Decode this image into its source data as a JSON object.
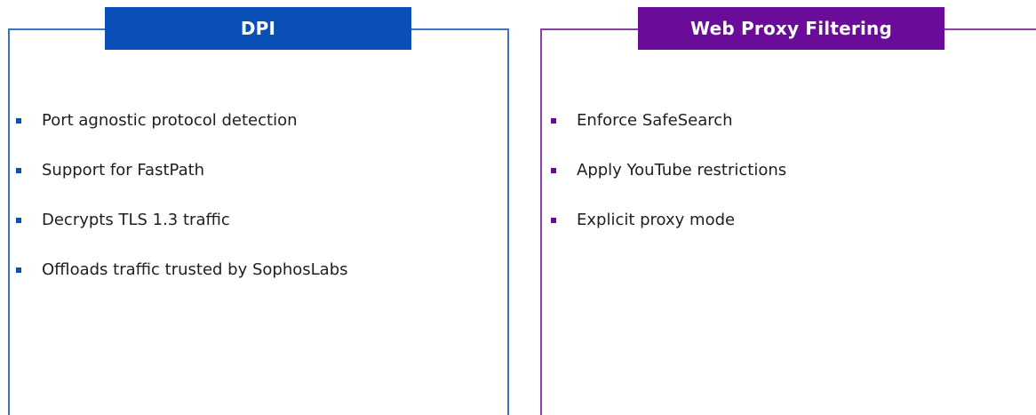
{
  "left_panel": {
    "title": "DPI",
    "accent_color": "#0a4fb6",
    "items": [
      "Port agnostic protocol detection",
      "Support for FastPath",
      "Decrypts TLS 1.3 traffic",
      "Offloads traffic trusted by SophosLabs"
    ]
  },
  "right_panel": {
    "title": "Web Proxy Filtering",
    "accent_color": "#6a0b9a",
    "items": [
      "Enforce SafeSearch",
      "Apply YouTube restrictions",
      "Explicit proxy mode"
    ]
  }
}
